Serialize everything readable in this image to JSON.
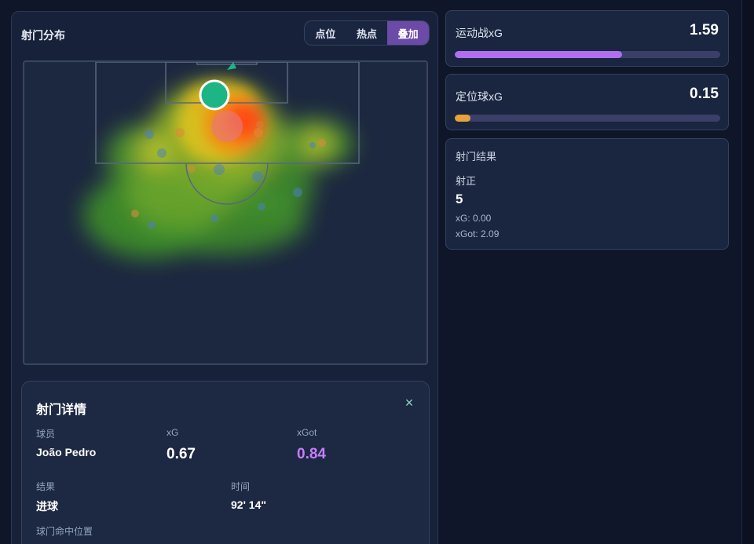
{
  "shot_map": {
    "title": "射门分布",
    "views": [
      "点位",
      "热点",
      "叠加"
    ],
    "active_view": "叠加"
  },
  "detail": {
    "title": "射门详情",
    "close_icon": "×",
    "player_label": "球员",
    "player_value": "João Pedro",
    "xg_label": "xG",
    "xg_value": "0.67",
    "xgot_label": "xGot",
    "xgot_value": "0.84",
    "result_label": "结果",
    "result_value": "进球",
    "time_label": "时间",
    "time_value": "92' 14\"",
    "goal_location_label": "球门命中位置"
  },
  "open_play": {
    "label": "运动战xG",
    "value": "1.59",
    "bar_fraction": 0.63,
    "color": "#b16ef0"
  },
  "set_piece": {
    "label": "定位球xG",
    "value": "0.15",
    "bar_fraction": 0.06,
    "color": "#e8a23a"
  },
  "results": {
    "title": "射门结果",
    "category": "射正",
    "count": "5",
    "xg_line": "xG: 0.00",
    "xgot_line": "xGot: 2.09"
  },
  "colors": {
    "goal_marker": "#1db584",
    "active_tab": "#6b4aa8",
    "accent_purple": "#c77dff"
  }
}
